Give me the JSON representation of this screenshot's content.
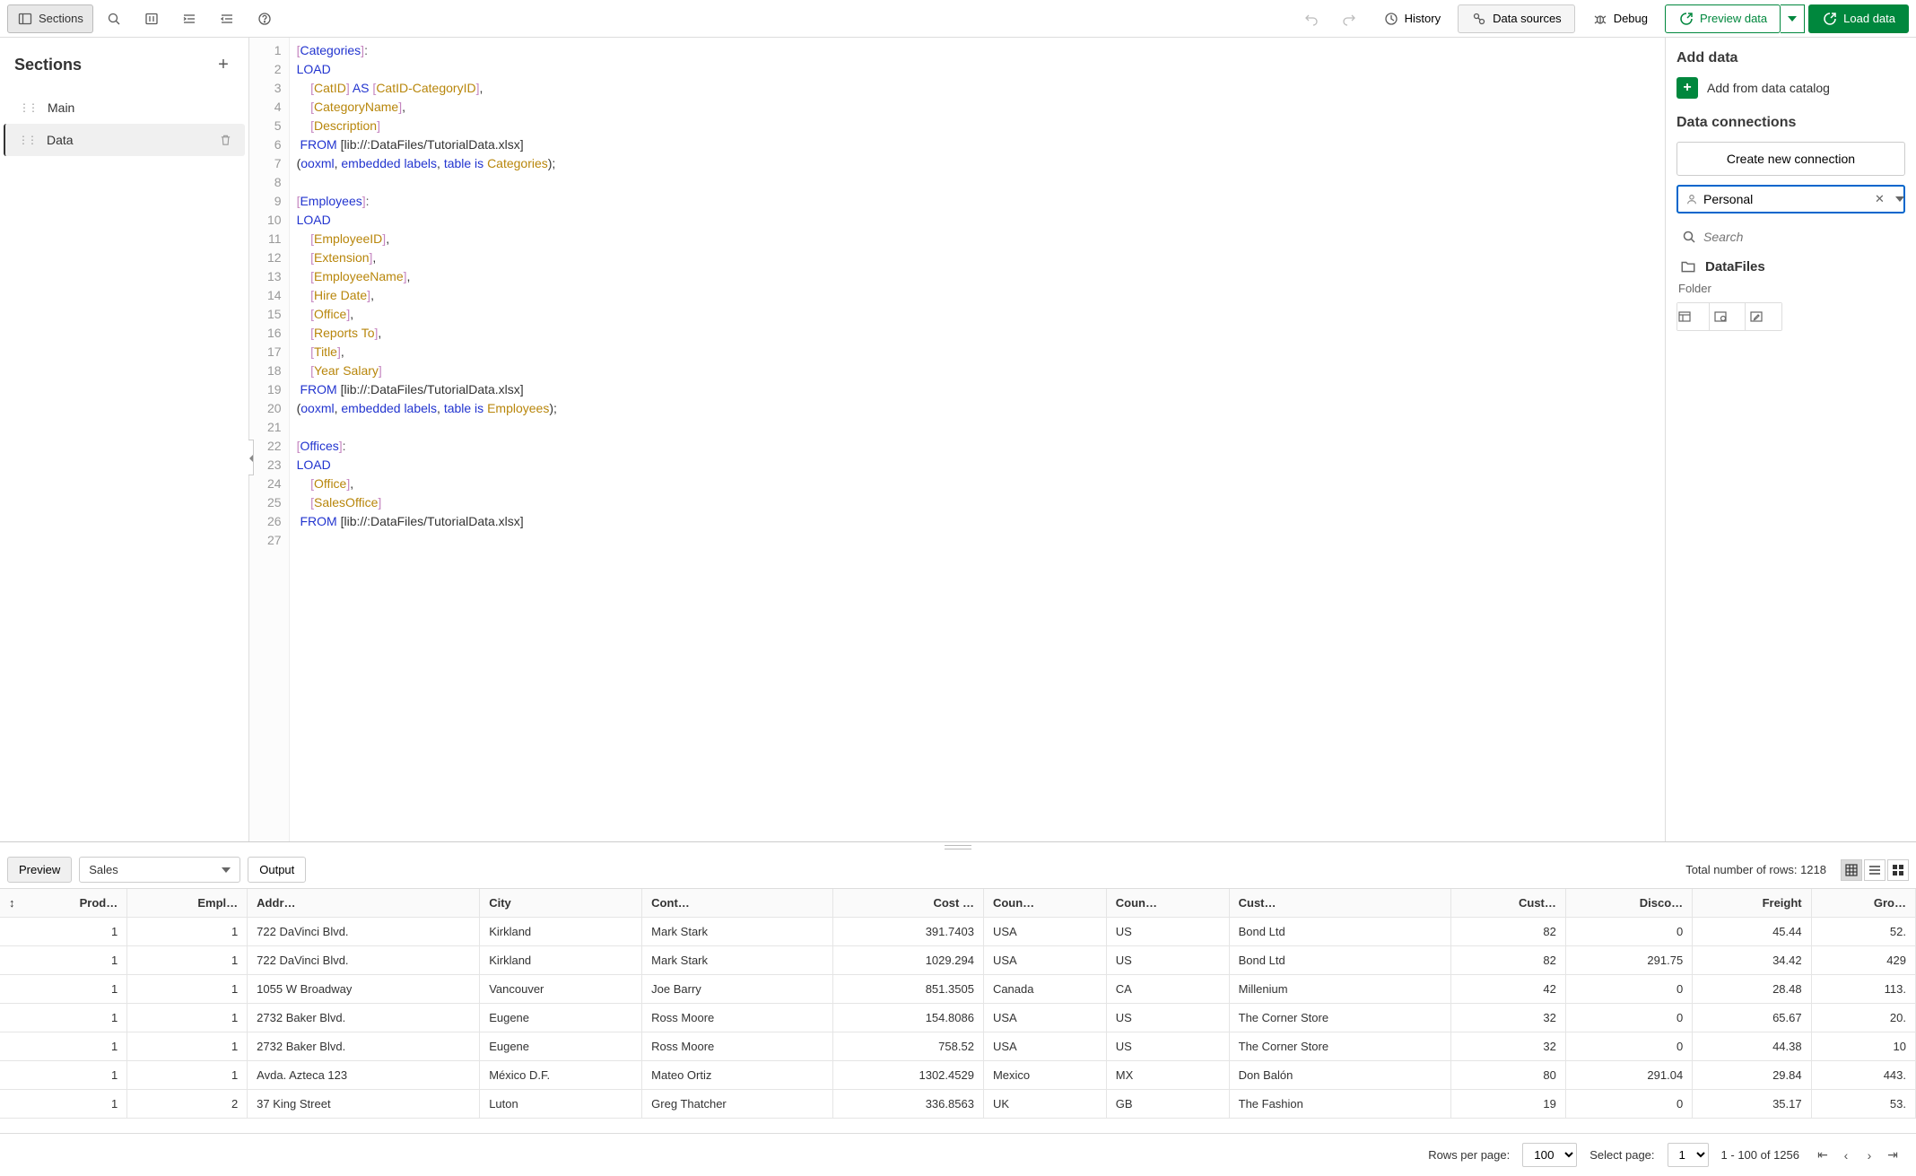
{
  "topbar": {
    "sections_btn": "Sections",
    "history": "History",
    "data_sources": "Data sources",
    "debug": "Debug",
    "preview_data": "Preview data",
    "load_data": "Load data"
  },
  "sidebar": {
    "title": "Sections",
    "items": [
      {
        "label": "Main"
      },
      {
        "label": "Data"
      }
    ]
  },
  "editor": {
    "lines": [
      {
        "n": 1,
        "html": "<span class='tk-b'>[</span><span class='tk-kw'>Categories</span><span class='tk-b'>]</span><span class='tk-op'>:</span>"
      },
      {
        "n": 2,
        "html": "<span class='tk-kw'>LOAD</span>"
      },
      {
        "n": 3,
        "html": "    <span class='tk-b'>[</span><span class='tk-id'>CatID</span><span class='tk-b'>]</span> <span class='tk-kw'>AS</span> <span class='tk-b'>[</span><span class='tk-id'>CatID-CategoryID</span><span class='tk-b'>]</span>,"
      },
      {
        "n": 4,
        "html": "    <span class='tk-b'>[</span><span class='tk-id'>CategoryName</span><span class='tk-b'>]</span>,"
      },
      {
        "n": 5,
        "html": "    <span class='tk-b'>[</span><span class='tk-id'>Description</span><span class='tk-b'>]</span>"
      },
      {
        "n": 6,
        "html": " <span class='tk-kw'>FROM</span> <span class='tk-str'>[lib://:DataFiles/TutorialData.xlsx]</span>"
      },
      {
        "n": 7,
        "html": "(<span class='tk-kw'>ooxml</span>, <span class='tk-kw'>embedded labels</span>, <span class='tk-kw'>table is</span> <span class='tk-id'>Categories</span>);"
      },
      {
        "n": 8,
        "html": ""
      },
      {
        "n": 9,
        "html": "<span class='tk-b'>[</span><span class='tk-kw'>Employees</span><span class='tk-b'>]</span><span class='tk-op'>:</span>"
      },
      {
        "n": 10,
        "html": "<span class='tk-kw'>LOAD</span>"
      },
      {
        "n": 11,
        "html": "    <span class='tk-b'>[</span><span class='tk-id'>EmployeeID</span><span class='tk-b'>]</span>,"
      },
      {
        "n": 12,
        "html": "    <span class='tk-b'>[</span><span class='tk-id'>Extension</span><span class='tk-b'>]</span>,"
      },
      {
        "n": 13,
        "html": "    <span class='tk-b'>[</span><span class='tk-id'>EmployeeName</span><span class='tk-b'>]</span>,"
      },
      {
        "n": 14,
        "html": "    <span class='tk-b'>[</span><span class='tk-id'>Hire Date</span><span class='tk-b'>]</span>,"
      },
      {
        "n": 15,
        "html": "    <span class='tk-b'>[</span><span class='tk-id'>Office</span><span class='tk-b'>]</span>,"
      },
      {
        "n": 16,
        "html": "    <span class='tk-b'>[</span><span class='tk-id'>Reports To</span><span class='tk-b'>]</span>,"
      },
      {
        "n": 17,
        "html": "    <span class='tk-b'>[</span><span class='tk-id'>Title</span><span class='tk-b'>]</span>,"
      },
      {
        "n": 18,
        "html": "    <span class='tk-b'>[</span><span class='tk-id'>Year Salary</span><span class='tk-b'>]</span>"
      },
      {
        "n": 19,
        "html": " <span class='tk-kw'>FROM</span> <span class='tk-str'>[lib://:DataFiles/TutorialData.xlsx]</span>"
      },
      {
        "n": 20,
        "html": "(<span class='tk-kw'>ooxml</span>, <span class='tk-kw'>embedded labels</span>, <span class='tk-kw'>table is</span> <span class='tk-id'>Employees</span>);"
      },
      {
        "n": 21,
        "html": ""
      },
      {
        "n": 22,
        "html": "<span class='tk-b'>[</span><span class='tk-kw'>Offices</span><span class='tk-b'>]</span><span class='tk-op'>:</span>"
      },
      {
        "n": 23,
        "html": "<span class='tk-kw'>LOAD</span>"
      },
      {
        "n": 24,
        "html": "    <span class='tk-b'>[</span><span class='tk-id'>Office</span><span class='tk-b'>]</span>,"
      },
      {
        "n": 25,
        "html": "    <span class='tk-b'>[</span><span class='tk-id'>SalesOffice</span><span class='tk-b'>]</span>"
      },
      {
        "n": 26,
        "html": " <span class='tk-kw'>FROM</span> <span class='tk-str'>[lib://:DataFiles/TutorialData.xlsx]</span>"
      },
      {
        "n": 27,
        "html": ""
      }
    ]
  },
  "rpanel": {
    "add_data": "Add data",
    "catalog": "Add from data catalog",
    "connections": "Data connections",
    "create_conn": "Create new connection",
    "space_value": "Personal",
    "search_placeholder": "Search",
    "folder_name": "DataFiles",
    "folder_type": "Folder"
  },
  "preview": {
    "tab_preview": "Preview",
    "tab_output": "Output",
    "table_select": "Sales",
    "total_rows_label": "Total number of rows: ",
    "total_rows": "1218",
    "columns": [
      "Prod…",
      "Empl…",
      "Addr…",
      "City",
      "Cont…",
      "Cost …",
      "Coun…",
      "Coun…",
      "Cust…",
      "Cust…",
      "Disco…",
      "Freight",
      "Gro…"
    ],
    "rows": [
      [
        "1",
        "1",
        "722 DaVinci Blvd.",
        "Kirkland",
        "Mark Stark",
        "391.7403",
        "USA",
        "US",
        "Bond Ltd",
        "82",
        "0",
        "45.44",
        "52."
      ],
      [
        "1",
        "1",
        "722 DaVinci Blvd.",
        "Kirkland",
        "Mark Stark",
        "1029.294",
        "USA",
        "US",
        "Bond Ltd",
        "82",
        "291.75",
        "34.42",
        "429"
      ],
      [
        "1",
        "1",
        "1055 W Broadway",
        "Vancouver",
        "Joe Barry",
        "851.3505",
        "Canada",
        "CA",
        "Millenium",
        "42",
        "0",
        "28.48",
        "113."
      ],
      [
        "1",
        "1",
        "2732 Baker Blvd.",
        "Eugene",
        "Ross Moore",
        "154.8086",
        "USA",
        "US",
        "The Corner Store",
        "32",
        "0",
        "65.67",
        "20."
      ],
      [
        "1",
        "1",
        "2732 Baker Blvd.",
        "Eugene",
        "Ross Moore",
        "758.52",
        "USA",
        "US",
        "The Corner Store",
        "32",
        "0",
        "44.38",
        "10"
      ],
      [
        "1",
        "1",
        "Avda. Azteca 123",
        "México D.F.",
        "Mateo Ortiz",
        "1302.4529",
        "Mexico",
        "MX",
        "Don Balón",
        "80",
        "291.04",
        "29.84",
        "443."
      ],
      [
        "1",
        "2",
        "37 King Street",
        "Luton",
        "Greg Thatcher",
        "336.8563",
        "UK",
        "GB",
        "The Fashion",
        "19",
        "0",
        "35.17",
        "53."
      ]
    ],
    "numeric_cols": [
      0,
      1,
      5,
      9,
      10,
      11,
      12
    ]
  },
  "pager": {
    "rows_label": "Rows per page:",
    "rows_value": "100",
    "select_label": "Select page:",
    "select_value": "1",
    "range": "1 - 100 of 1256"
  }
}
